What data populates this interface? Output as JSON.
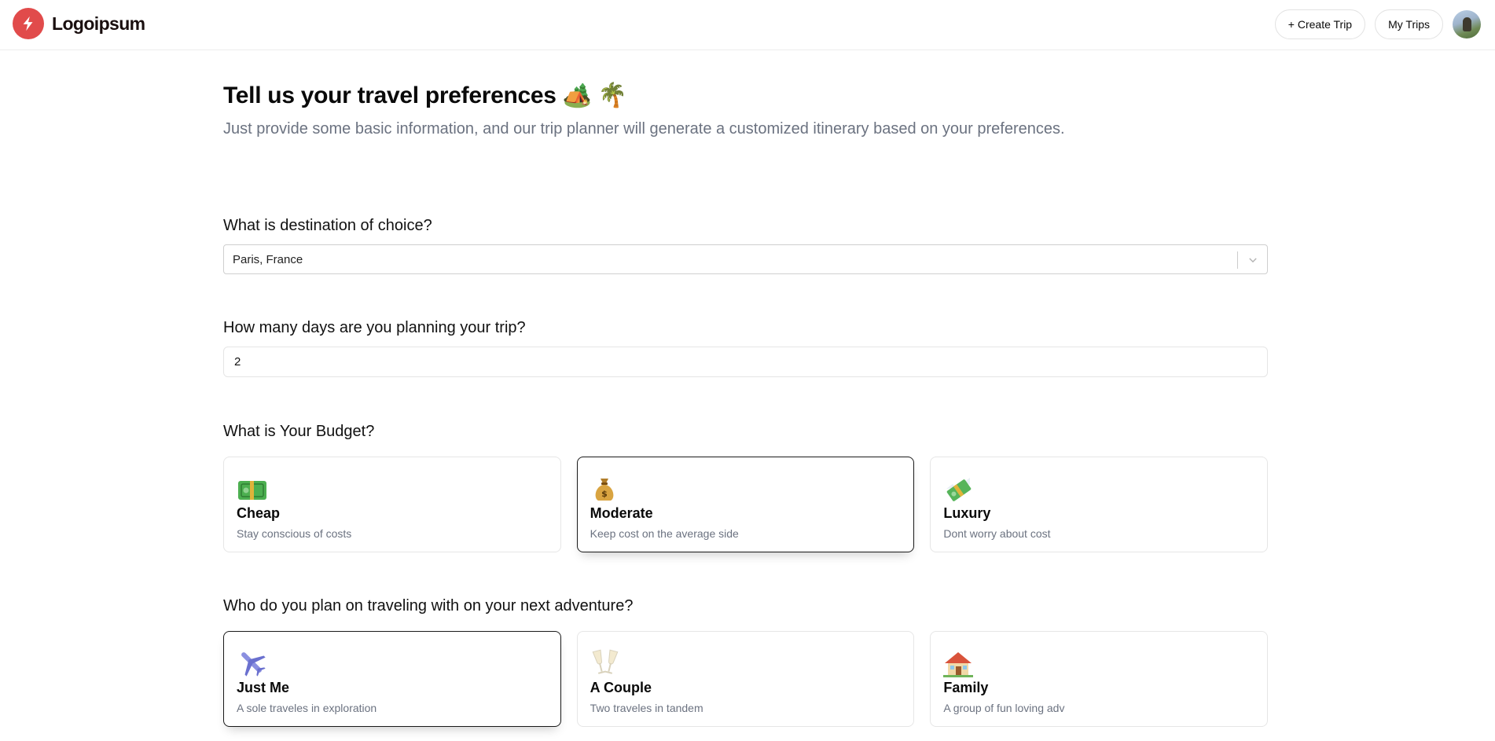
{
  "header": {
    "brand": "Logoipsum",
    "create_trip_label": "+ Create Trip",
    "my_trips_label": "My Trips"
  },
  "page": {
    "title": "Tell us your travel preferences 🏕️ 🌴",
    "subtitle": "Just provide some basic information, and our trip planner will generate a customized itinerary based on your preferences."
  },
  "destination": {
    "question": "What is destination of choice?",
    "value": "Paris, France"
  },
  "days": {
    "question": "How many days are you planning your trip?",
    "value": "2"
  },
  "budget": {
    "question": "What is Your Budget?",
    "options": [
      {
        "icon": "💵",
        "icon_name": "cash-icon",
        "title": "Cheap",
        "desc": "Stay conscious of costs",
        "selected": false
      },
      {
        "icon": "💰",
        "icon_name": "money-bag-icon",
        "title": "Moderate",
        "desc": "Keep cost on the average side",
        "selected": true
      },
      {
        "icon": "💸",
        "icon_name": "flying-money-icon",
        "title": "Luxury",
        "desc": "Dont worry about cost",
        "selected": false
      }
    ]
  },
  "travelers": {
    "question": "Who do you plan on traveling with on your next adventure?",
    "options": [
      {
        "icon": "✈️",
        "icon_name": "airplane-icon",
        "title": "Just Me",
        "desc": "A sole traveles in exploration",
        "selected": true
      },
      {
        "icon": "🥂",
        "icon_name": "champagne-glasses-icon",
        "title": "A Couple",
        "desc": "Two traveles in tandem",
        "selected": false
      },
      {
        "icon": "🏡",
        "icon_name": "house-icon",
        "title": "Family",
        "desc": "A group of fun loving adv",
        "selected": false
      }
    ]
  },
  "colors": {
    "brand": "#e14b4b",
    "muted_text": "#6b7280",
    "selected_border": "#1a1a1a"
  }
}
